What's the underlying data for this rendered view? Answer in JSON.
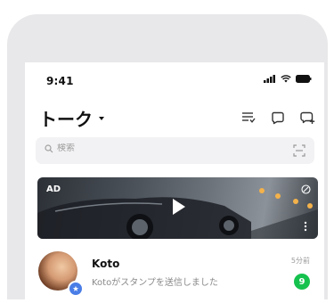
{
  "status_bar": {
    "time": "9:41",
    "icons": [
      "signal-icon",
      "wifi-icon",
      "battery-icon"
    ]
  },
  "header": {
    "title": "トーク",
    "icons": [
      "sort-icon",
      "chat-bubble-icon",
      "new-chat-icon"
    ]
  },
  "search": {
    "placeholder": "検索",
    "icon": "search-icon",
    "scan_icon": "qr-scan-icon"
  },
  "ad": {
    "label": "AD",
    "icons": [
      "play-icon",
      "close-circle-icon",
      "more-vert-icon"
    ]
  },
  "chats": [
    {
      "name": "Koto",
      "message": "Kotoがスタンプを送信しました",
      "time": "5分前",
      "unread": "9"
    }
  ],
  "colors": {
    "frame": "#e8e8ea",
    "search_bg": "#f2f2f4",
    "unread_badge": "#16c24e",
    "official_badge": "#4a7de6"
  }
}
